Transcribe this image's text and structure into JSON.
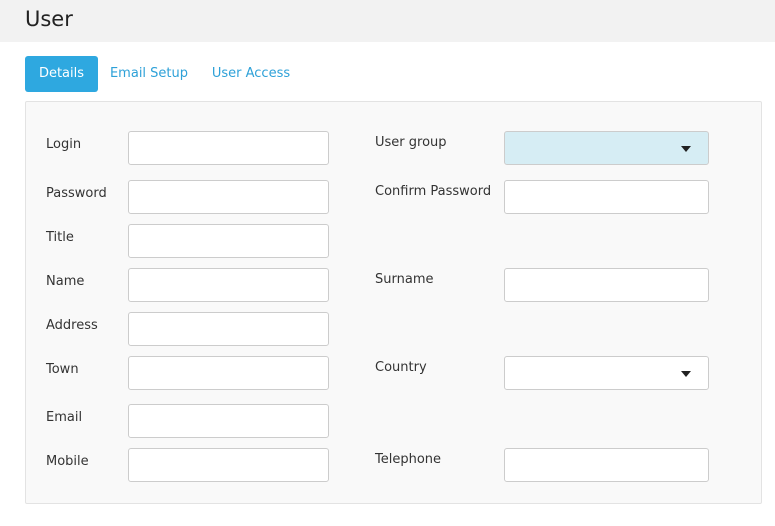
{
  "header": {
    "title": "User"
  },
  "tabs": [
    {
      "label": "Details",
      "active": true
    },
    {
      "label": "Email Setup",
      "active": false
    },
    {
      "label": "User Access",
      "active": false
    }
  ],
  "form": {
    "left": {
      "login": {
        "label": "Login",
        "value": ""
      },
      "password": {
        "label": "Password",
        "value": ""
      },
      "title": {
        "label": "Title",
        "value": ""
      },
      "name": {
        "label": "Name",
        "value": ""
      },
      "address": {
        "label": "Address",
        "value": ""
      },
      "town": {
        "label": "Town",
        "value": ""
      },
      "email": {
        "label": "Email",
        "value": ""
      },
      "mobile": {
        "label": "Mobile",
        "value": ""
      }
    },
    "right": {
      "user_group": {
        "label": "User group",
        "value": ""
      },
      "confirm_password": {
        "label": "Confirm Password",
        "value": ""
      },
      "surname": {
        "label": "Surname",
        "value": ""
      },
      "country": {
        "label": "Country",
        "value": ""
      },
      "telephone": {
        "label": "Telephone",
        "value": ""
      }
    }
  },
  "colors": {
    "accent": "#2ea8e0",
    "tab_link": "#2ea1d8",
    "user_group_bg": "#d6edf4"
  },
  "icons": {
    "dropdown": "caret-down-icon"
  }
}
